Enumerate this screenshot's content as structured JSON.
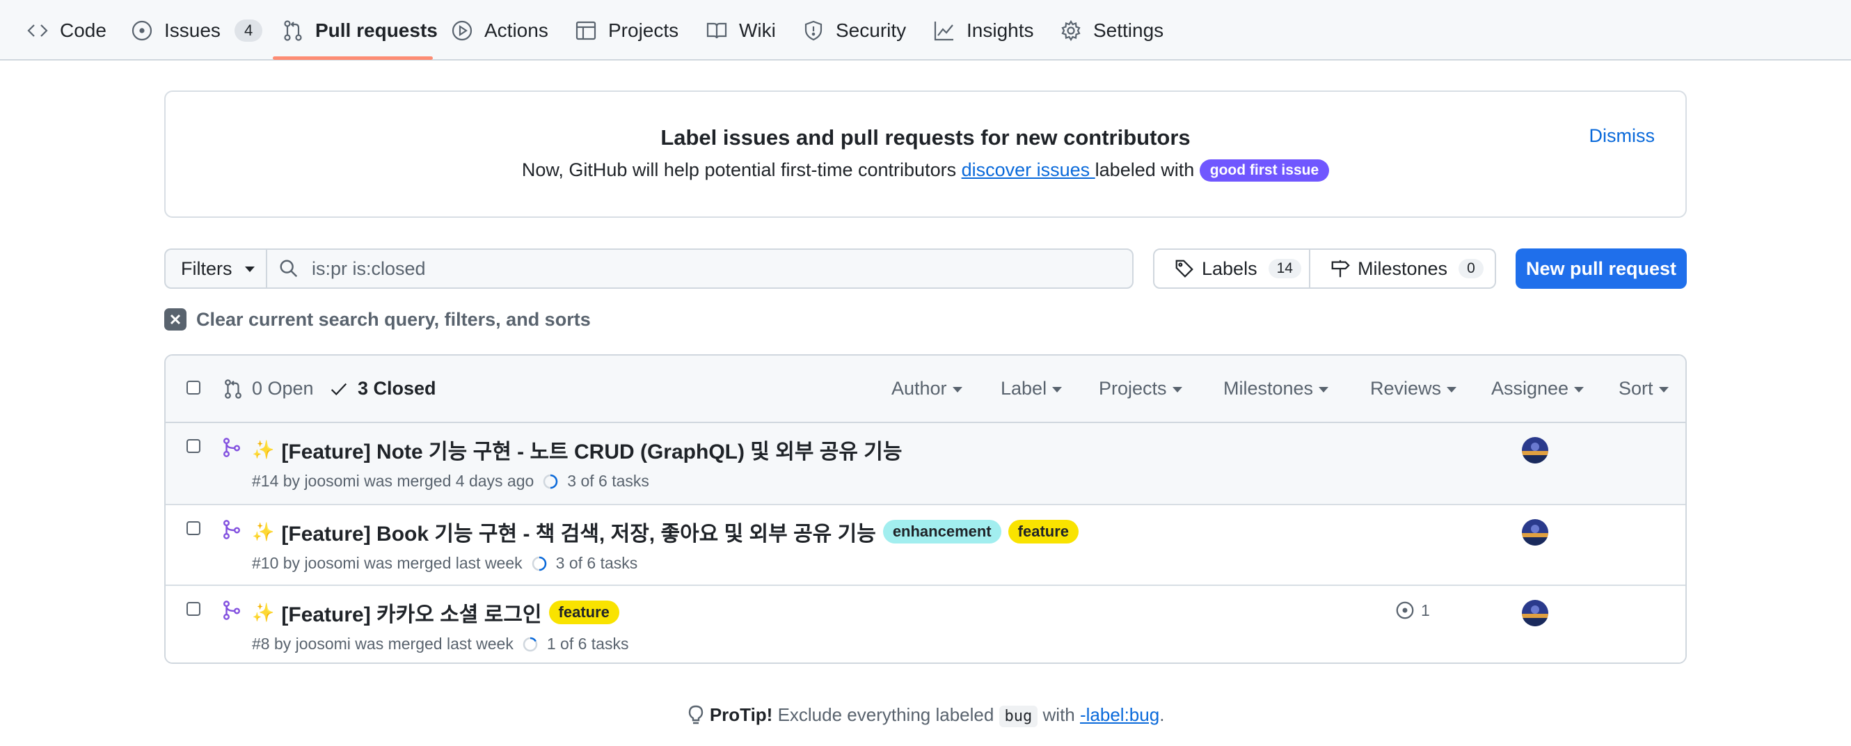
{
  "nav": {
    "tabs": [
      {
        "label": "Code",
        "icon": "code-icon"
      },
      {
        "label": "Issues",
        "icon": "issue-opened-icon",
        "count": "4"
      },
      {
        "label": "Pull requests",
        "icon": "git-pull-request-icon",
        "selected": true
      },
      {
        "label": "Actions",
        "icon": "play-icon"
      },
      {
        "label": "Projects",
        "icon": "table-icon"
      },
      {
        "label": "Wiki",
        "icon": "book-icon"
      },
      {
        "label": "Security",
        "icon": "shield-icon"
      },
      {
        "label": "Insights",
        "icon": "graph-icon"
      },
      {
        "label": "Settings",
        "icon": "gear-icon"
      }
    ]
  },
  "banner": {
    "title": "Label issues and pull requests for new contributors",
    "text_before": "Now, GitHub will help potential first-time contributors ",
    "link": "discover issues ",
    "text_after": "labeled with ",
    "pill": "good first issue",
    "dismiss": "Dismiss"
  },
  "toolbar": {
    "filters_label": "Filters",
    "search_value": "is:pr is:closed",
    "labels_label": "Labels",
    "labels_count": "14",
    "milestones_label": "Milestones",
    "milestones_count": "0",
    "new_pr_label": "New pull request",
    "clear_label": "Clear current search query, filters, and sorts"
  },
  "list_header": {
    "open": "0 Open",
    "closed": "3 Closed",
    "filters": [
      "Author",
      "Label",
      "Projects",
      "Milestones",
      "Reviews",
      "Assignee",
      "Sort"
    ]
  },
  "pulls": [
    {
      "title": "[Feature] Note 기능 구현 - 노트 CRUD (GraphQL) 및 외부 공유 기능",
      "meta": "#14 by joosomi was merged 4 days ago",
      "tasks": "3 of 6 tasks",
      "labels": [],
      "comments": ""
    },
    {
      "title": "[Feature] Book 기능 구현 - 책 검색, 저장, 좋아요 및 외부 공유 기능",
      "meta": "#10 by joosomi was merged last week",
      "tasks": "3 of 6 tasks",
      "labels": [
        {
          "name": "enhancement",
          "color": "#a2eeef"
        },
        {
          "name": "feature",
          "color": "#f9e300"
        }
      ],
      "comments": ""
    },
    {
      "title": "[Feature] 카카오 소셜 로그인",
      "meta": "#8 by joosomi was merged last week",
      "tasks": "1 of 6 tasks",
      "labels": [
        {
          "name": "feature",
          "color": "#f9e300"
        }
      ],
      "comments": "1"
    }
  ],
  "protip": {
    "lead": "ProTip!",
    "text": " Exclude everything labeled ",
    "code": "bug",
    "with": " with ",
    "link": "-label:bug",
    "end": "."
  },
  "colors": {
    "merged": "#8250df",
    "primary_button": "#1f6feb",
    "link": "#0969da",
    "tab_underline": "#fd8c73"
  }
}
